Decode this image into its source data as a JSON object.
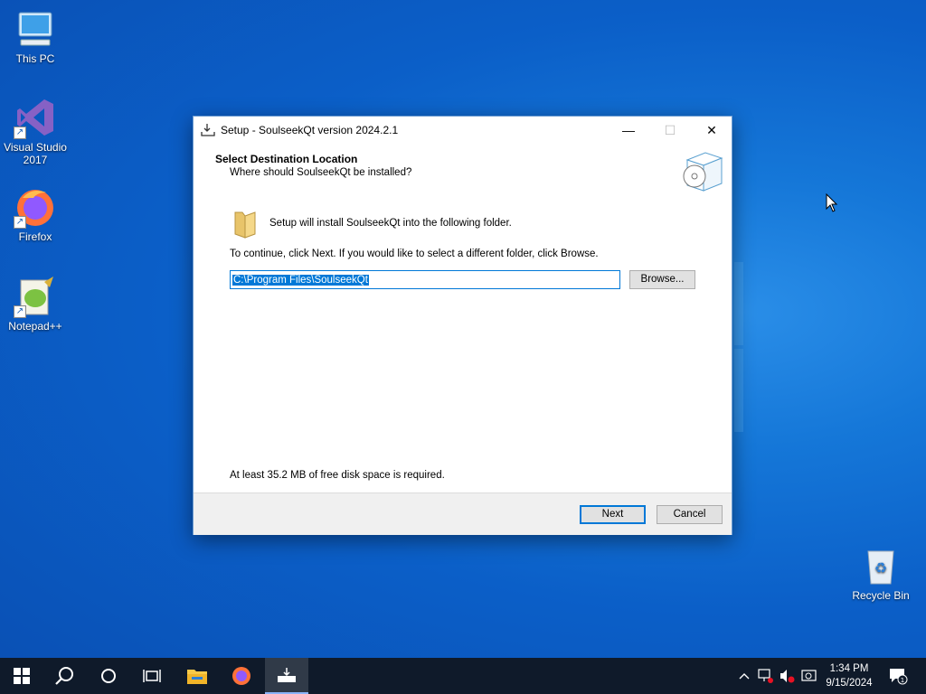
{
  "desktop": {
    "icons": [
      {
        "label": "This PC",
        "icon": "computer-icon"
      },
      {
        "label": "Visual Studio 2017",
        "icon": "visual-studio-icon"
      },
      {
        "label": "Firefox",
        "icon": "firefox-icon"
      },
      {
        "label": "Notepad++",
        "icon": "notepad-plus-plus-icon"
      },
      {
        "label": "Recycle Bin",
        "icon": "recycle-bin-icon"
      }
    ]
  },
  "dialog": {
    "title": "Setup - SoulseekQt version 2024.2.1",
    "header_title": "Select Destination Location",
    "header_subtitle": "Where should SoulseekQt be installed?",
    "setup_text": "Setup will install SoulseekQt into the following folder.",
    "continue_text": "To continue, click Next. If you would like to select a different folder, click Browse.",
    "path_value": "C:\\Program Files\\SoulseekQt",
    "browse_label": "Browse...",
    "space_text": "At least 35.2 MB of free disk space is required.",
    "next_label": "Next",
    "cancel_label": "Cancel"
  },
  "taskbar": {
    "items": [
      "start-icon",
      "search-icon",
      "cortana-icon",
      "task-view-icon",
      "file-explorer-icon",
      "firefox-icon",
      "setup-icon"
    ],
    "time": "1:34 PM",
    "date": "9/15/2024",
    "notification_count": "1"
  },
  "colors": {
    "accent": "#0078d7",
    "taskbar": "#0f1a2a",
    "desktop": "#0b5fc8"
  }
}
